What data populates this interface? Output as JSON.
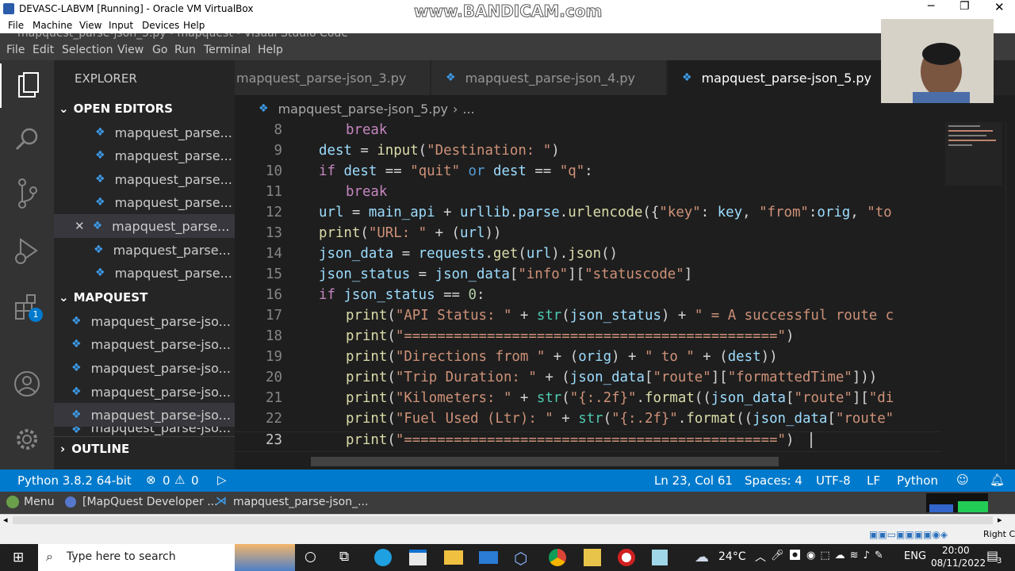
{
  "vbox": {
    "title": "DEVASC-LABVM [Running] - Oracle VM VirtualBox",
    "watermark": "www.BANDICAM.com",
    "menu": [
      "File",
      "Machine",
      "View",
      "Input",
      "Devices",
      "Help"
    ]
  },
  "vscode": {
    "window_title": "mapquest_parse-json_5.py - mapquest - Visual Studio Code",
    "menu": [
      "File",
      "Edit",
      "Selection",
      "View",
      "Go",
      "Run",
      "Terminal",
      "Help"
    ],
    "explorer_title": "EXPLORER",
    "open_editors_label": "OPEN EDITORS",
    "open_editors": [
      "mapquest_parse...",
      "mapquest_parse...",
      "mapquest_parse...",
      "mapquest_parse...",
      "mapquest_parse...",
      "mapquest_parse...",
      "mapquest_parse..."
    ],
    "folder_label": "MAPQUEST",
    "folder_files": [
      "mapquest_parse-jso...",
      "mapquest_parse-jso...",
      "mapquest_parse-jso...",
      "mapquest_parse-jso...",
      "mapquest_parse-jso...",
      "mapquest_parse-jso..."
    ],
    "outline_label": "OUTLINE",
    "tabs": [
      "mapquest_parse-json_3.py",
      "mapquest_parse-json_4.py",
      "mapquest_parse-json_5.py"
    ],
    "breadcrumb_file": "mapquest_parse-json_5.py",
    "breadcrumb_more": "...",
    "extensions_badge": "1",
    "line_numbers": [
      "8",
      "9",
      "10",
      "11",
      "12",
      "13",
      "14",
      "15",
      "16",
      "17",
      "18",
      "19",
      "20",
      "21",
      "22",
      "23"
    ]
  },
  "status": {
    "python": "Python 3.8.2 64-bit",
    "errors": "0",
    "warnings": "0",
    "position": "Ln 23, Col 61",
    "spaces": "Spaces: 4",
    "encoding": "UTF-8",
    "eol": "LF",
    "language": "Python"
  },
  "vm_panel": {
    "menu": "Menu",
    "task1": "[MapQuest Developer ...",
    "task2": "mapquest_parse-json_..."
  },
  "vbox_status": {
    "host_key": "Right Ctrl"
  },
  "taskbar": {
    "search_placeholder": "Type here to search",
    "temperature": "24°C",
    "lang": "ENG",
    "time": "20:00",
    "date": "08/11/2022",
    "notification_count": "3"
  }
}
